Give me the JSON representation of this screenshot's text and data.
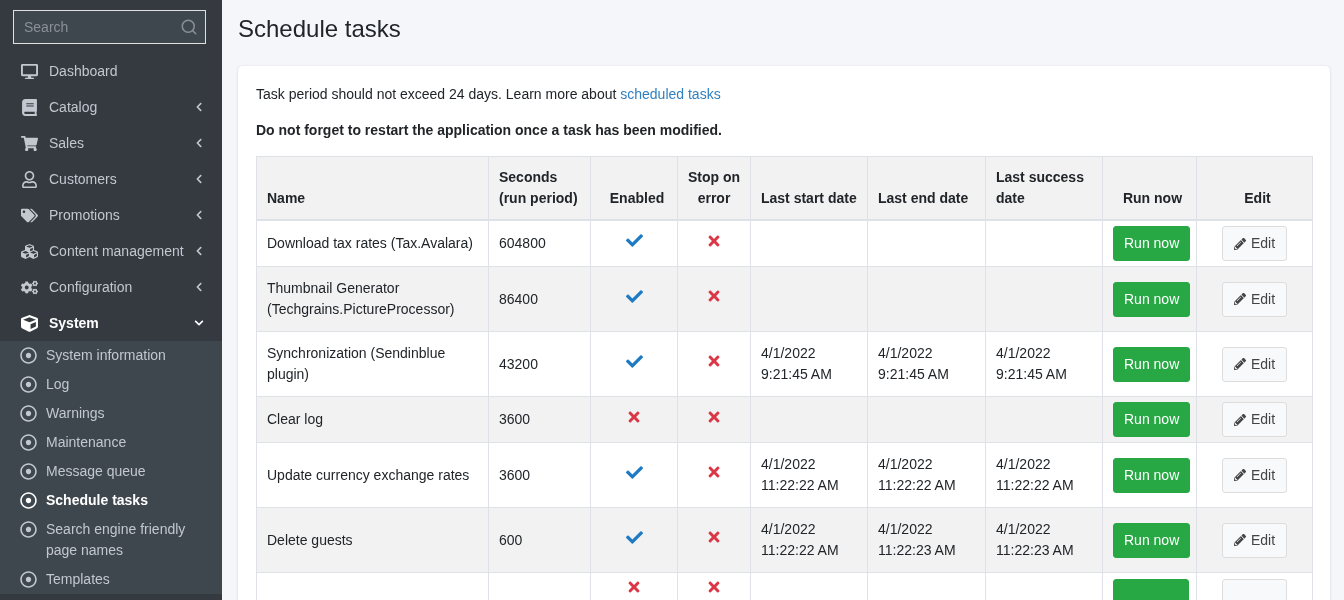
{
  "sidebar": {
    "search": {
      "placeholder": "Search"
    },
    "items": [
      {
        "label": "Dashboard",
        "kind": "link",
        "expanded": false
      },
      {
        "label": "Catalog",
        "kind": "menu",
        "expanded": false
      },
      {
        "label": "Sales",
        "kind": "menu",
        "expanded": false
      },
      {
        "label": "Customers",
        "kind": "menu",
        "expanded": false
      },
      {
        "label": "Promotions",
        "kind": "menu",
        "expanded": false
      },
      {
        "label": "Content management",
        "kind": "menu",
        "expanded": false
      },
      {
        "label": "Configuration",
        "kind": "menu",
        "expanded": false
      },
      {
        "label": "System",
        "kind": "menu",
        "expanded": true,
        "children": [
          {
            "label": "System information",
            "selected": false
          },
          {
            "label": "Log",
            "selected": false
          },
          {
            "label": "Warnings",
            "selected": false
          },
          {
            "label": "Maintenance",
            "selected": false
          },
          {
            "label": "Message queue",
            "selected": false
          },
          {
            "label": "Schedule tasks",
            "selected": true
          },
          {
            "label": "Search engine friendly page names",
            "selected": false
          },
          {
            "label": "Templates",
            "selected": false
          }
        ]
      }
    ]
  },
  "page": {
    "title": "Schedule tasks",
    "info": "Task period should not exceed 24 days. Learn more about",
    "info_link": "scheduled tasks",
    "warning": "Do not forget to restart the application once a task has been modified.",
    "table": {
      "columns": [
        "Name",
        "Seconds (run period)",
        "Enabled",
        "Stop on error",
        "Last start date",
        "Last end date",
        "Last success date",
        "Run now",
        "Edit"
      ],
      "rows": [
        {
          "name": "Download tax rates (Tax.Avalara)",
          "seconds": "604800",
          "enabled": true,
          "stop_on_error": false,
          "run": "Run now",
          "edit": "Edit"
        },
        {
          "name": "Thumbnail Generator (Techgrains.PictureProcessor)",
          "seconds": "86400",
          "enabled": true,
          "stop_on_error": false,
          "run": "Run now",
          "edit": "Edit"
        },
        {
          "name": "Synchronization (Sendinblue plugin)",
          "seconds": "43200",
          "enabled": true,
          "stop_on_error": false,
          "last_start": "4/1/2022 9:21:45 AM",
          "last_end": "4/1/2022 9:21:45 AM",
          "last_success": "4/1/2022 9:21:45 AM",
          "run": "Run now",
          "edit": "Edit"
        },
        {
          "name": "Clear log",
          "seconds": "3600",
          "enabled": false,
          "stop_on_error": false,
          "run": "Run now",
          "edit": "Edit"
        },
        {
          "name": "Update currency exchange rates",
          "seconds": "3600",
          "enabled": true,
          "stop_on_error": false,
          "last_start": "4/1/2022 11:22:22 AM",
          "last_end": "4/1/2022 11:22:22 AM",
          "last_success": "4/1/2022 11:22:22 AM",
          "run": "Run now",
          "edit": "Edit"
        },
        {
          "name": "Delete guests",
          "seconds": "600",
          "enabled": true,
          "stop_on_error": false,
          "last_start": "4/1/2022 11:22:22 AM",
          "last_end": "4/1/2022 11:22:23 AM",
          "last_success": "4/1/2022 11:22:23 AM",
          "run": "Run now",
          "edit": "Edit"
        },
        {
          "enabled": false,
          "stop_on_error": false
        }
      ]
    }
  }
}
